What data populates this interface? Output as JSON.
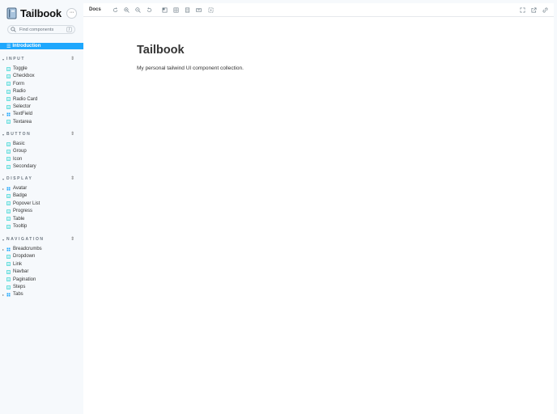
{
  "brand": {
    "title": "Tailbook"
  },
  "search": {
    "placeholder": "Find components",
    "shortcut": "/"
  },
  "sidebar": {
    "intro": {
      "label": "Introduction"
    },
    "groups": [
      {
        "label": "INPUT",
        "items": [
          {
            "label": "Toggle"
          },
          {
            "label": "Checkbox"
          },
          {
            "label": "Form"
          },
          {
            "label": "Radio"
          },
          {
            "label": "Radio Card"
          },
          {
            "label": "Selector"
          },
          {
            "label": "TextField"
          },
          {
            "label": "Textarea"
          }
        ]
      },
      {
        "label": "BUTTON",
        "items": [
          {
            "label": "Basic"
          },
          {
            "label": "Group"
          },
          {
            "label": "Icon"
          },
          {
            "label": "Secondary"
          }
        ]
      },
      {
        "label": "DISPLAY",
        "items": [
          {
            "label": "Avatar"
          },
          {
            "label": "Badge"
          },
          {
            "label": "Popover List"
          },
          {
            "label": "Progress"
          },
          {
            "label": "Table"
          },
          {
            "label": "Tooltip"
          }
        ]
      },
      {
        "label": "NAVIGATION",
        "items": [
          {
            "label": "Breadcrumbs"
          },
          {
            "label": "Dropdown"
          },
          {
            "label": "Link"
          },
          {
            "label": "Navbar"
          },
          {
            "label": "Pagination"
          },
          {
            "label": "Steps"
          },
          {
            "label": "Tabs"
          }
        ]
      }
    ]
  },
  "toolbar": {
    "active_tab": "Docs"
  },
  "doc": {
    "title": "Tailbook",
    "description": "My personal tailwind UI component collection."
  },
  "colors": {
    "accent": "#1ea7fd",
    "component_icon": "#1ea7fd",
    "story_icon": "#37d5d3"
  }
}
